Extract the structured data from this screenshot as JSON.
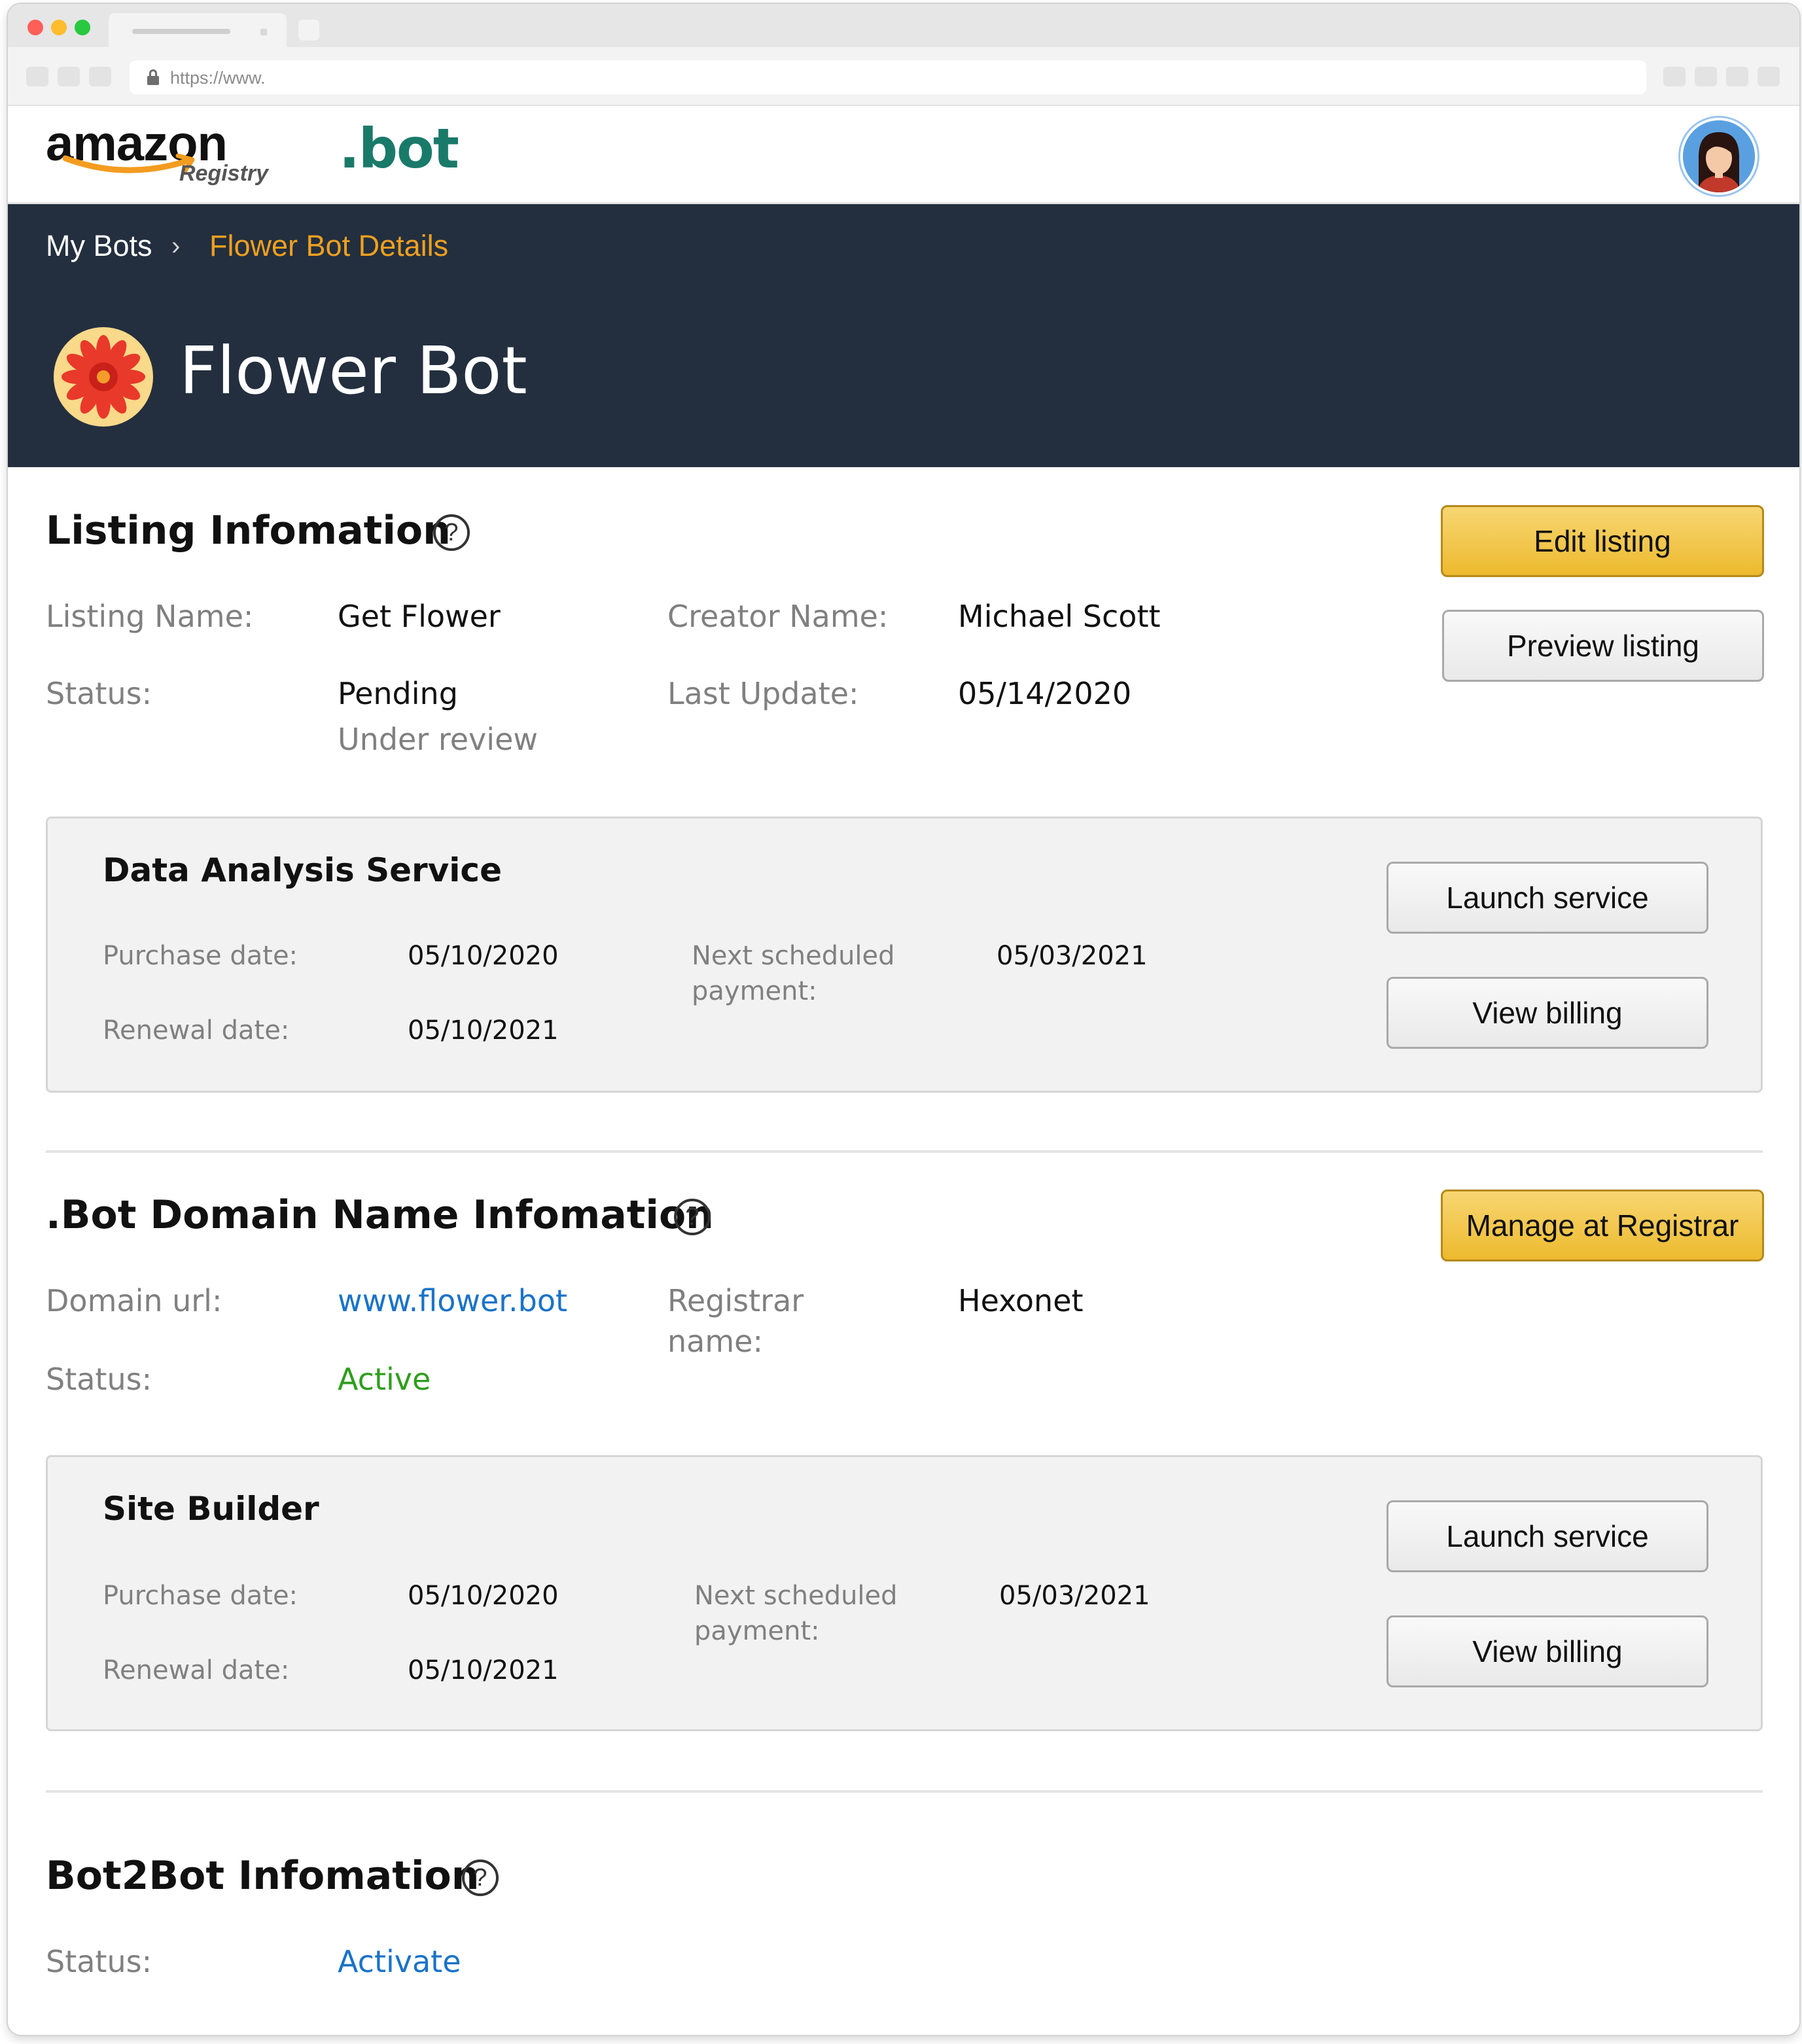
{
  "browser": {
    "url": "https://www."
  },
  "header": {
    "amazon_word": "amazon",
    "registry_word": "Registry",
    "bot_word": ".bot"
  },
  "breadcrumb": {
    "root": "My Bots",
    "separator": "›",
    "current": "Flower Bot Details"
  },
  "hero": {
    "title": "Flower Bot"
  },
  "listing": {
    "heading": "Listing Infomation",
    "help": "?",
    "name_label": "Listing Name:",
    "name_value": "Get Flower",
    "creator_label": "Creator Name:",
    "creator_value": "Michael Scott",
    "status_label": "Status:",
    "status_value": "Pending",
    "status_sub": "Under review",
    "update_label": "Last Update:",
    "update_value": "05/14/2020",
    "edit_button": "Edit listing",
    "preview_button": "Preview listing"
  },
  "data_service": {
    "title": "Data Analysis Service",
    "purchase_label": "Purchase date:",
    "purchase_value": "05/10/2020",
    "renewal_label": "Renewal date:",
    "renewal_value": "05/10/2021",
    "next_label_1": "Next scheduled",
    "next_label_2": "payment:",
    "next_value": "05/03/2021",
    "launch_button": "Launch service",
    "billing_button": "View billing"
  },
  "domain": {
    "heading": ".Bot Domain Name Infomation",
    "help": "?",
    "url_label": "Domain url:",
    "url_value": "www.flower.bot",
    "registrar_label_1": "Registrar",
    "registrar_label_2": "name:",
    "registrar_value": "Hexonet",
    "status_label": "Status:",
    "status_value": "Active",
    "manage_button": "Manage at Registrar"
  },
  "site_builder": {
    "title": "Site Builder",
    "purchase_label": "Purchase date:",
    "purchase_value": "05/10/2020",
    "renewal_label": "Renewal date:",
    "renewal_value": "05/10/2021",
    "next_label_1": "Next scheduled",
    "next_label_2": "payment:",
    "next_value": "05/03/2021",
    "launch_button": "Launch service",
    "billing_button": "View billing"
  },
  "bot2bot": {
    "heading": "Bot2Bot Infomation",
    "help": "?",
    "status_label": "Status:",
    "status_value": "Activate"
  },
  "colors": {
    "hero_bg": "#232f3e",
    "breadcrumb_active": "#f0a020",
    "primary_button": "#edba2e",
    "link": "#1a73c8",
    "active": "#2e9e1c",
    "bot_logo": "#1a7a6a"
  }
}
